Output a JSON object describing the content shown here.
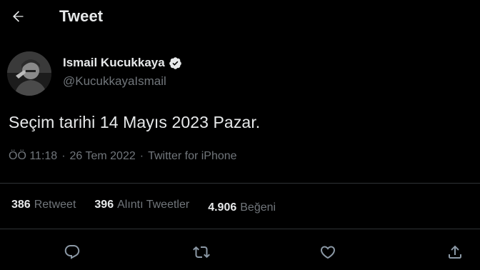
{
  "header": {
    "back_icon": "arrow-left-icon",
    "title": "Tweet"
  },
  "author": {
    "name": "Ismail Kucukkaya",
    "handle": "@KucukkayaIsmail",
    "verified_icon": "verified-badge-icon"
  },
  "tweet": {
    "text": "Seçim tarihi 14 Mayıs 2023 Pazar.",
    "time": "ÖÖ 11:18",
    "separator": "·",
    "date": "26 Tem 2022",
    "source": "Twitter for iPhone"
  },
  "stats": {
    "retweets": {
      "count": "386",
      "label": "Retweet"
    },
    "quotes": {
      "count": "396",
      "label": "Alıntı Tweetler"
    },
    "likes": {
      "count": "4.906",
      "label": "Beğeni"
    }
  },
  "actions": [
    {
      "name": "reply",
      "icon": "reply-icon"
    },
    {
      "name": "retweet",
      "icon": "retweet-icon"
    },
    {
      "name": "like",
      "icon": "heart-icon"
    },
    {
      "name": "share",
      "icon": "share-icon"
    }
  ],
  "colors": {
    "background": "#000000",
    "text": "#e7e9ea",
    "secondary_text": "#71767b",
    "divider": "#2f3336",
    "verified": "#e7e9ea"
  }
}
